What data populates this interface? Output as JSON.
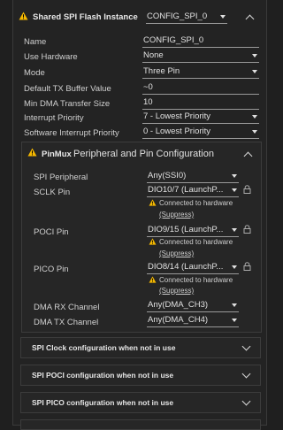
{
  "header": {
    "title": "Shared SPI Flash Instance",
    "instance_select": "CONFIG_SPI_0"
  },
  "fields": [
    {
      "label": "Name",
      "value": "CONFIG_SPI_0",
      "kind": "input"
    },
    {
      "label": "Use Hardware",
      "value": "None",
      "kind": "select"
    },
    {
      "label": "Mode",
      "value": "Three Pin",
      "kind": "select"
    },
    {
      "label": "Default TX Buffer Value",
      "value": "~0",
      "kind": "input"
    },
    {
      "label": "Min DMA Transfer Size",
      "value": "10",
      "kind": "input"
    },
    {
      "label": "Interrupt Priority",
      "value": "7 - Lowest Priority",
      "kind": "select"
    },
    {
      "label": "Software Interrupt Priority",
      "value": "0 - Lowest Priority",
      "kind": "select"
    }
  ],
  "pinmux": {
    "title": "PinMux",
    "subtitle": "Peripheral and Pin Configuration",
    "rows": [
      {
        "label": "SPI Peripheral",
        "value": "Any(SSI0)"
      },
      {
        "label": "SCLK Pin",
        "value": "DIO10/7 (LaunchP..."
      },
      {
        "label": "POCI Pin",
        "value": "DIO9/15 (LaunchP..."
      },
      {
        "label": "PICO Pin",
        "value": "DIO8/14 (LaunchP..."
      },
      {
        "label": "DMA RX Channel",
        "value": "Any(DMA_CH3)"
      },
      {
        "label": "DMA TX Channel",
        "value": "Any(DMA_CH4)"
      }
    ],
    "note_text": "Connected to hardware",
    "note_link": "(Suppress)"
  },
  "sections": [
    {
      "title": "SPI Clock configuration when not in use"
    },
    {
      "title": "SPI POCI configuration when not in use"
    },
    {
      "title": "SPI PICO configuration when not in use"
    }
  ],
  "colors": {
    "warning": "#f5b800",
    "background": "#232323",
    "border": "#3c3c3c"
  }
}
